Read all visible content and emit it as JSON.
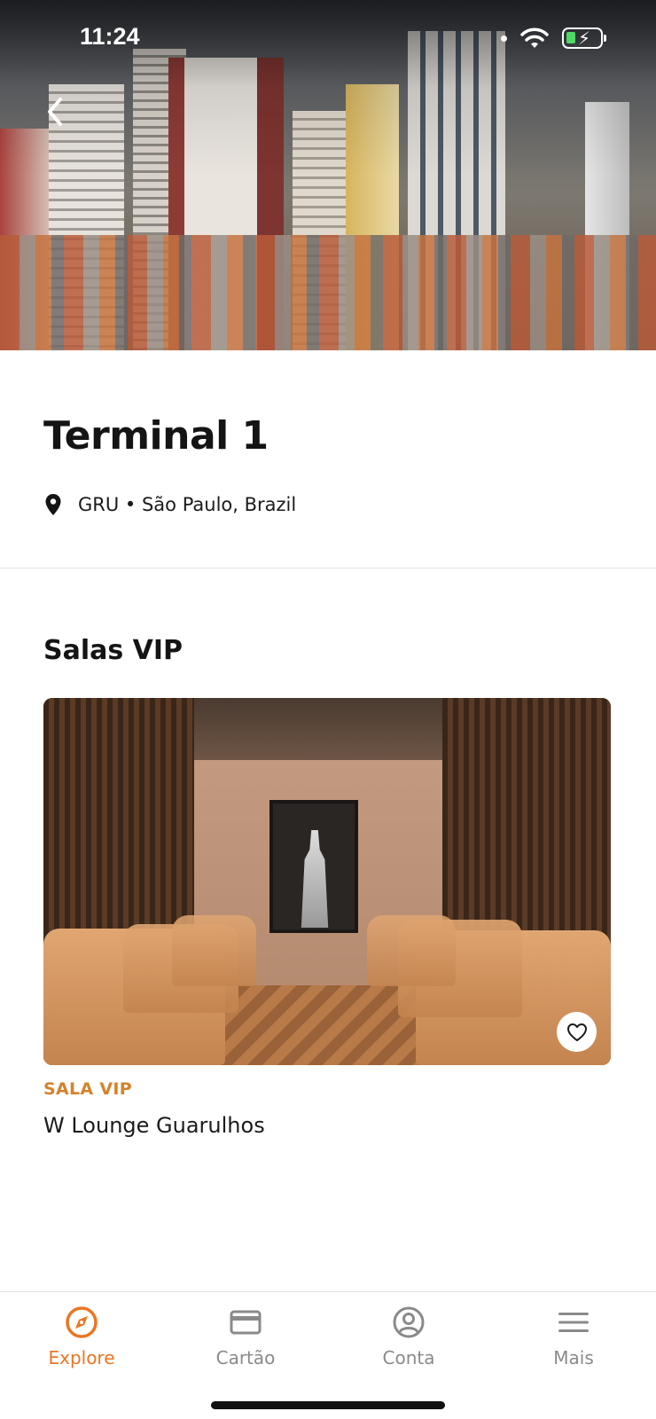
{
  "status_bar": {
    "time": "11:24"
  },
  "hero": {
    "image": "São Paulo city skyline"
  },
  "terminal": {
    "title": "Terminal 1",
    "location": "GRU • São Paulo, Brazil"
  },
  "section": {
    "title": "Salas VIP"
  },
  "lounges": [
    {
      "category": "SALA VIP",
      "name": "W Lounge Guarulhos"
    }
  ],
  "bottom_nav": {
    "items": [
      {
        "label": "Explore",
        "icon": "compass-icon",
        "active": true
      },
      {
        "label": "Cartão",
        "icon": "card-icon",
        "active": false
      },
      {
        "label": "Conta",
        "icon": "user-circle-icon",
        "active": false
      },
      {
        "label": "Mais",
        "icon": "menu-icon",
        "active": false
      }
    ]
  },
  "colors": {
    "accent": "#ec7523",
    "category": "#d5822a",
    "inactive": "#8a8a8a"
  }
}
